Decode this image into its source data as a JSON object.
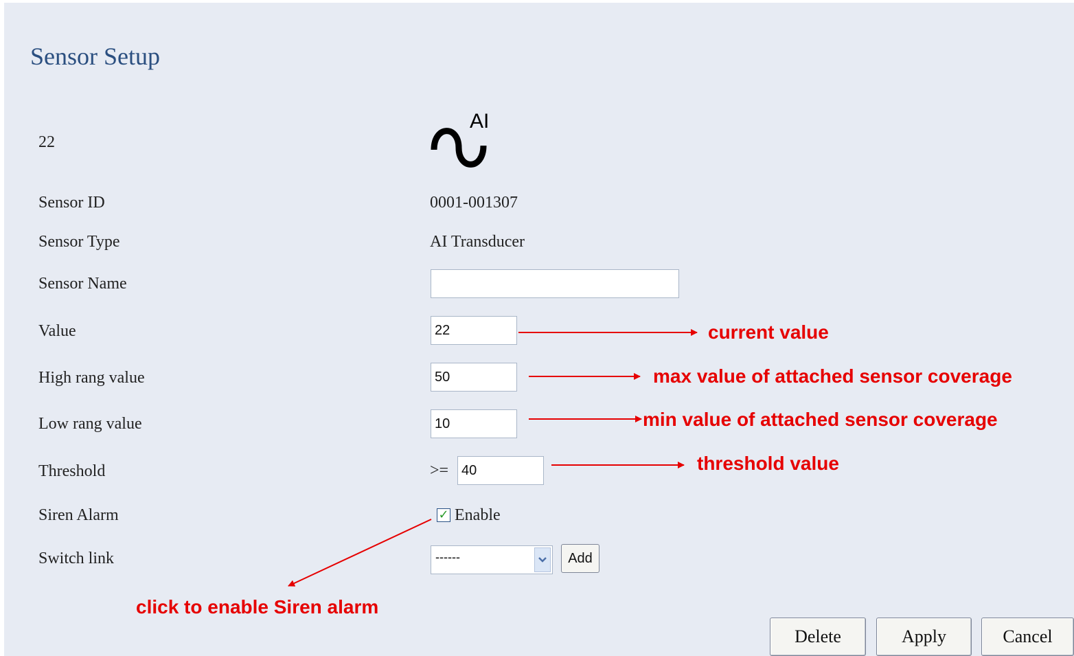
{
  "page": {
    "title": "Sensor Setup"
  },
  "sensor": {
    "index_label": "22",
    "icon_label": "AI",
    "icon_name": "analog-wave-icon"
  },
  "fields": {
    "sensor_id": {
      "label": "Sensor ID",
      "value": "0001-001307"
    },
    "sensor_type": {
      "label": "Sensor Type",
      "value": "AI Transducer"
    },
    "sensor_name": {
      "label": "Sensor Name",
      "value": ""
    },
    "value": {
      "label": "Value",
      "value": "22"
    },
    "high_range": {
      "label": "High rang value",
      "value": "50"
    },
    "low_range": {
      "label": "Low rang value",
      "value": "10"
    },
    "threshold": {
      "label": "Threshold",
      "operator": ">=",
      "value": "40"
    },
    "siren_alarm": {
      "label": "Siren Alarm",
      "checkbox_label": "Enable",
      "checked": true
    },
    "switch_link": {
      "label": "Switch link",
      "selected": "------",
      "add_label": "Add"
    }
  },
  "annotations": {
    "current_value": "current value",
    "max_value": "max value of attached sensor coverage",
    "min_value": "min value of attached sensor coverage",
    "threshold_value": "threshold value",
    "siren_hint": "click to enable Siren alarm"
  },
  "buttons": {
    "delete": "Delete",
    "apply": "Apply",
    "cancel": "Cancel"
  },
  "colors": {
    "annotation": "#e60000",
    "title": "#2b4f80",
    "background": "#e7ebf3"
  }
}
